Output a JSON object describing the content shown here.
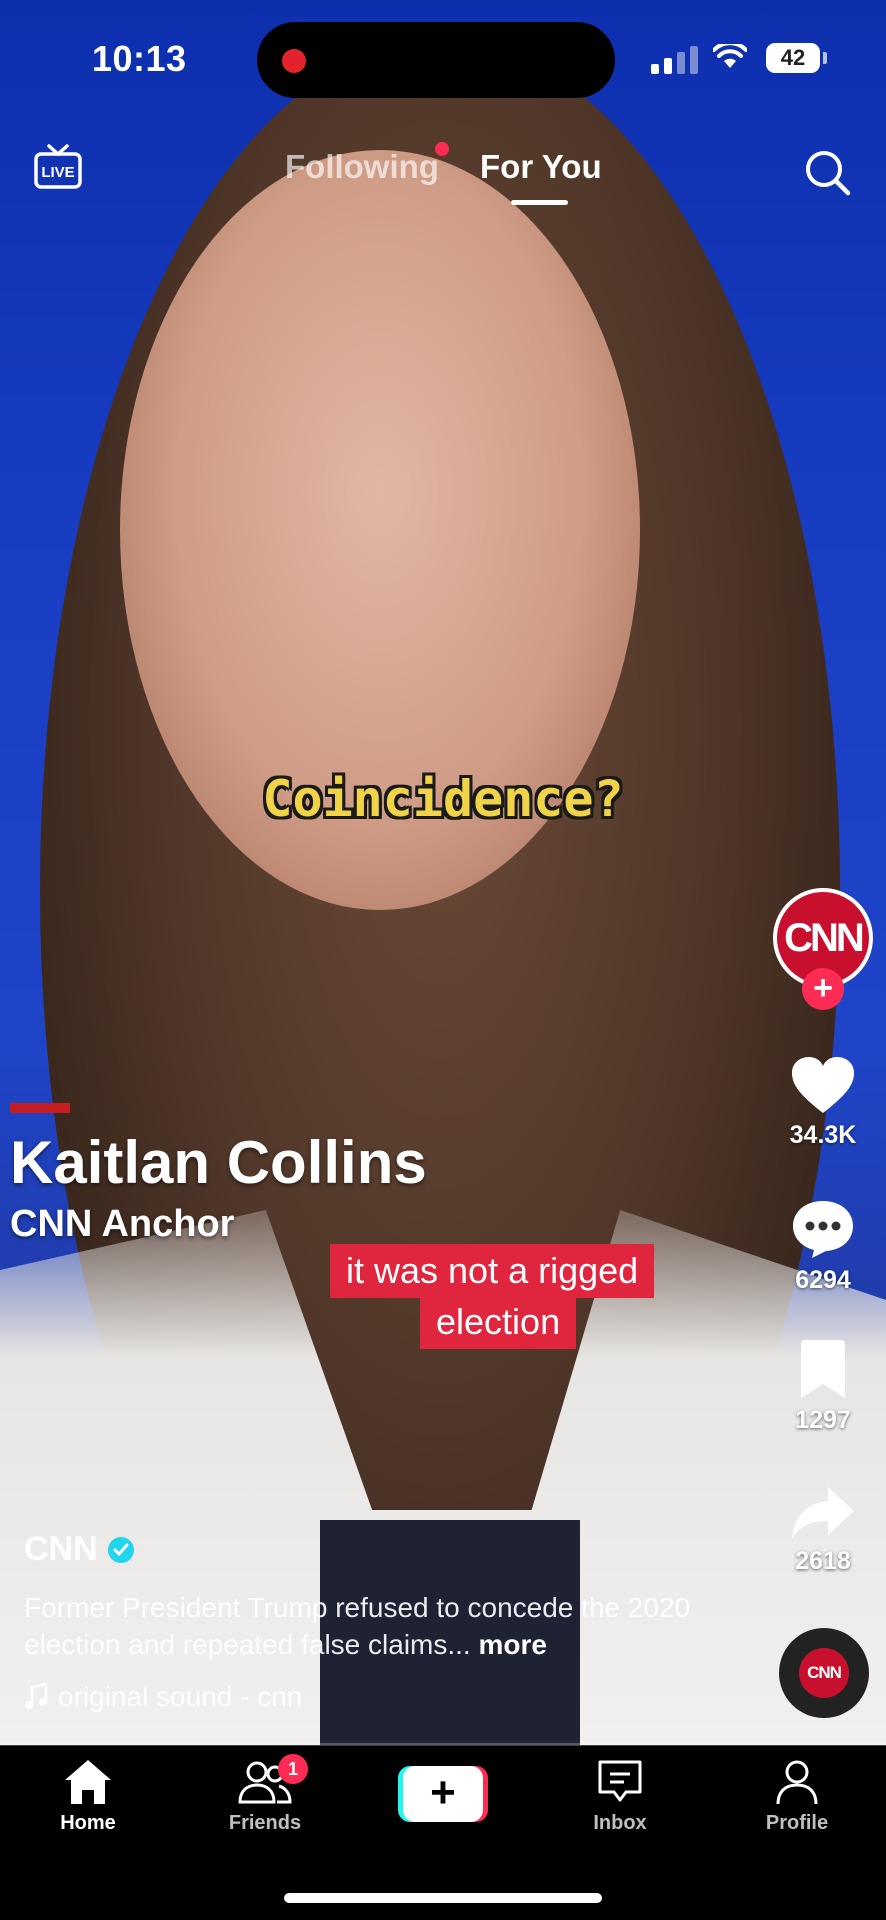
{
  "status_bar": {
    "time": "10:13",
    "battery": "42"
  },
  "top_nav": {
    "tabs": [
      {
        "label": "Following"
      },
      {
        "label": "For You"
      }
    ],
    "live_label": "LIVE"
  },
  "video": {
    "overlay_caption": "Coincidence?",
    "lower_third": {
      "name": "Kaitlan Collins",
      "title": "CNN Anchor"
    },
    "subtitle_line1": "it was not a rigged",
    "subtitle_line2": "election"
  },
  "actions": {
    "creator_avatar": "CNN",
    "likes": "34.3K",
    "comments": "6294",
    "saves": "1297",
    "shares": "2618"
  },
  "post": {
    "author": "CNN",
    "description": "Former President Trump refused to concede the 2020 election and repeated false claims...",
    "more_label": "more",
    "sound": "original sound - cnn",
    "disc_label": "CNN"
  },
  "tab_bar": {
    "home": "Home",
    "friends": "Friends",
    "friends_badge": "1",
    "create": "+",
    "inbox": "Inbox",
    "profile": "Profile"
  },
  "colors": {
    "accent": "#fe2c55",
    "cyan": "#25f4ee",
    "cnn_red": "#c8102e",
    "caption_yellow": "#f1d34a"
  }
}
